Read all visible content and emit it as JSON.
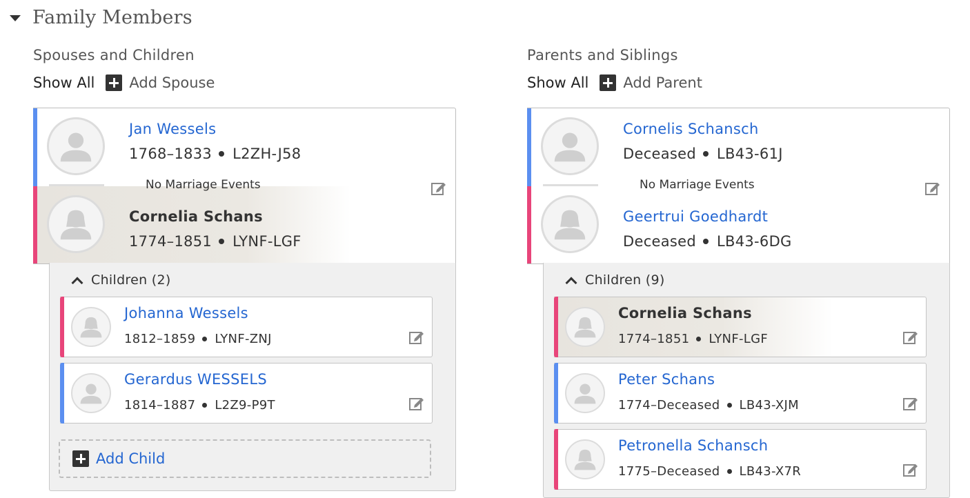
{
  "section": {
    "title": "Family Members"
  },
  "spouses": {
    "heading": "Spouses and Children",
    "show_all": "Show All",
    "add_label": "Add Spouse",
    "husband": {
      "name": "Jan Wessels",
      "dates": "1768–1833",
      "id": "L2ZH-J58"
    },
    "no_marriage": "No Marriage Events",
    "wife": {
      "name": "Cornelia Schans",
      "dates": "1774–1851",
      "id": "LYNF-LGF"
    },
    "children_toggle": "Children (2)",
    "children": [
      {
        "name": "Johanna Wessels",
        "dates": "1812–1859",
        "id": "LYNF-ZNJ",
        "gender": "female"
      },
      {
        "name": "Gerardus WESSELS",
        "dates": "1814–1887",
        "id": "L2Z9-P9T",
        "gender": "male"
      }
    ],
    "add_child": "Add Child"
  },
  "parents": {
    "heading": "Parents and Siblings",
    "show_all": "Show All",
    "add_label": "Add Parent",
    "father": {
      "name": "Cornelis Schansch",
      "dates": "Deceased",
      "id": "LB43-61J"
    },
    "no_marriage": "No Marriage Events",
    "mother": {
      "name": "Geertrui Goedhardt",
      "dates": "Deceased",
      "id": "LB43-6DG"
    },
    "children_toggle": "Children (9)",
    "children": [
      {
        "name": "Cornelia Schans",
        "dates": "1774–1851",
        "id": "LYNF-LGF",
        "gender": "female"
      },
      {
        "name": "Peter Schans",
        "dates": "1774–Deceased",
        "id": "LB43-XJM",
        "gender": "male"
      },
      {
        "name": "Petronella Schansch",
        "dates": "1775–Deceased",
        "id": "LB43-X7R",
        "gender": "female"
      }
    ]
  },
  "colors": {
    "male": "#5b8ff0",
    "female": "#e8457a",
    "link": "#2466d1"
  }
}
